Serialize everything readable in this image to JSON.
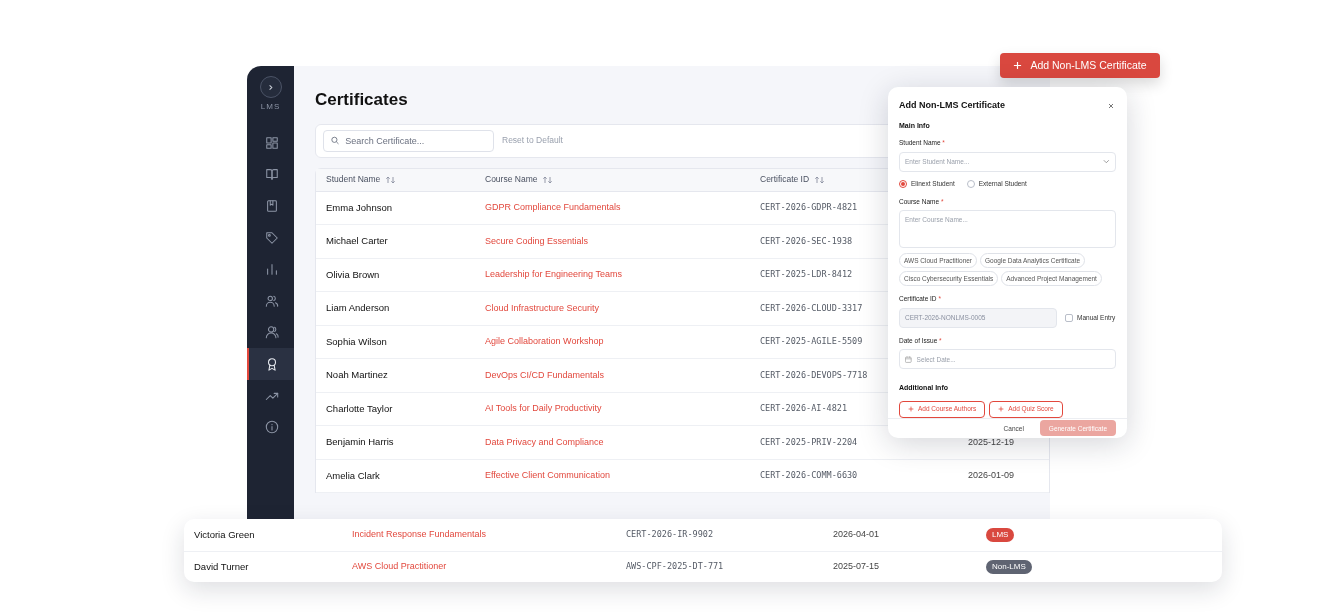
{
  "sidebar": {
    "label": "LMS",
    "items": [
      {
        "kind": "dashboard",
        "selected": false
      },
      {
        "kind": "book",
        "selected": false
      },
      {
        "kind": "journal",
        "selected": false
      },
      {
        "kind": "tag",
        "selected": false
      },
      {
        "kind": "chart",
        "selected": false
      },
      {
        "kind": "users",
        "selected": false
      },
      {
        "kind": "user-group",
        "selected": false
      },
      {
        "kind": "award",
        "selected": true
      },
      {
        "kind": "trend",
        "selected": false
      },
      {
        "kind": "info",
        "selected": false
      }
    ]
  },
  "page_title": "Certificates",
  "toolbar": {
    "search_placeholder": "Search Certificate...",
    "reset_label": "Reset to Default",
    "reset_disabled": true
  },
  "table": {
    "columns": [
      {
        "label": "Student Name",
        "sortable": true
      },
      {
        "label": "Course Name",
        "sortable": true
      },
      {
        "label": "Certificate ID",
        "sortable": true
      }
    ],
    "rows": [
      {
        "student": "Emma Johnson",
        "course": "GDPR Compliance Fundamentals",
        "certificate_id": "CERT-2026-GDPR-4821"
      },
      {
        "student": "Michael Carter",
        "course": "Secure Coding Essentials",
        "certificate_id": "CERT-2026-SEC-1938"
      },
      {
        "student": "Olivia Brown",
        "course": "Leadership for Engineering Teams",
        "certificate_id": "CERT-2025-LDR-8412"
      },
      {
        "student": "Liam Anderson",
        "course": "Cloud Infrastructure Security",
        "certificate_id": "CERT-2026-CLOUD-3317"
      },
      {
        "student": "Sophia Wilson",
        "course": "Agile Collaboration Workshop",
        "certificate_id": "CERT-2025-AGILE-5509"
      },
      {
        "student": "Noah Martinez",
        "course": "DevOps CI/CD Fundamentals",
        "certificate_id": "CERT-2026-DEVOPS-7718"
      },
      {
        "student": "Charlotte Taylor",
        "course": "AI Tools for Daily Productivity",
        "certificate_id": "CERT-2026-AI-4821"
      },
      {
        "student": "Benjamin Harris",
        "course": "Data Privacy and Compliance",
        "certificate_id": "CERT-2025-PRIV-2204",
        "date": "2025-12-19"
      },
      {
        "student": "Amelia Clark",
        "course": "Effective Client Communication",
        "certificate_id": "CERT-2026-COMM-6630",
        "date": "2026-01-09"
      }
    ]
  },
  "popup_rows": [
    {
      "student": "Victoria Green",
      "course": "Incident Response Fundamentals",
      "certificate_id": "CERT-2026-IR-9902",
      "date": "2026-04-01",
      "source": "LMS",
      "kind": "lms"
    },
    {
      "student": "David Turner",
      "course": "AWS Cloud Practitioner",
      "certificate_id": "AWS-CPF-2025-DT-771",
      "date": "2025-07-15",
      "source": "Non-LMS",
      "kind": "non-lms"
    }
  ],
  "add_button": {
    "label": "Add Non-LMS Certificate"
  },
  "modal": {
    "title": "Add Non-LMS Certificate",
    "main_section": "Main Info",
    "student_field": {
      "label": "Student Name",
      "required_mark": "*",
      "placeholder": "Enter Student Name..."
    },
    "student_type": [
      {
        "label": "Elinext Student",
        "selected": true
      },
      {
        "label": "External Student",
        "selected": false
      }
    ],
    "course_field": {
      "label": "Course Name",
      "required_mark": "*",
      "placeholder": "Enter Course Name..."
    },
    "suggestions": [
      "AWS Cloud Practitioner",
      "Google Data Analytics Certificate",
      "Cisco Cybersecurity Essentials",
      "Advanced Project Management"
    ],
    "certificate_field": {
      "label": "Certificate ID",
      "required_mark": "*",
      "value": "CERT-2026-NONLMS-0005",
      "disabled": true
    },
    "manual_entry": {
      "label": "Manual Entry",
      "checked": false
    },
    "date_field": {
      "label": "Date of Issue",
      "required_mark": "*",
      "placeholder": "Select Date..."
    },
    "additional_section": "Additional Info",
    "additional_buttons": [
      "Add Course Authors",
      "Add Quiz Score"
    ],
    "cancel_label": "Cancel",
    "submit": {
      "label": "Generate Certificate",
      "disabled": true
    }
  }
}
